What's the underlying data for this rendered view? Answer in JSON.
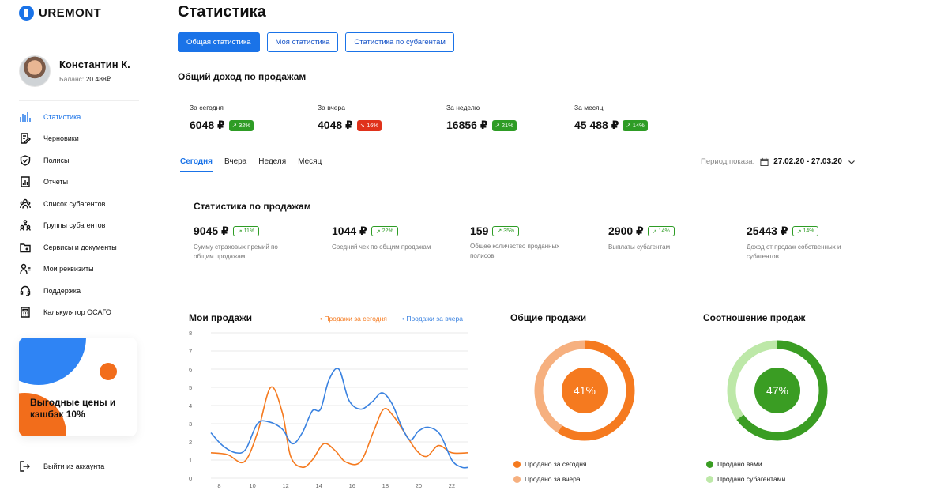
{
  "app": {
    "logo_text": "UREMONT"
  },
  "profile": {
    "name": "Константин К.",
    "balance_label": "Баланс:",
    "balance_value": "20 488₽"
  },
  "sidebar": {
    "items": [
      {
        "label": "Статистика",
        "icon": "bar-chart-icon",
        "active": true
      },
      {
        "label": "Черновики",
        "icon": "edit-document-icon"
      },
      {
        "label": "Полисы",
        "icon": "shield-icon"
      },
      {
        "label": "Отчеты",
        "icon": "report-icon"
      },
      {
        "label": "Список субагентов",
        "icon": "users-icon"
      },
      {
        "label": "Группы субагентов",
        "icon": "group-icon"
      },
      {
        "label": "Сервисы и документы",
        "icon": "folder-icon"
      },
      {
        "label": "Мои реквизиты",
        "icon": "user-details-icon"
      },
      {
        "label": "Поддержка",
        "icon": "headset-icon"
      },
      {
        "label": "Калькулятор ОСАГО",
        "icon": "calculator-icon"
      }
    ],
    "promo_text": "Выгодные цены и кэшбэк 10%",
    "logout_label": "Выйти из аккаунта"
  },
  "page": {
    "title": "Статистика",
    "tabs": [
      "Общая статистика",
      "Моя статистика",
      "Статистика по субагентам"
    ]
  },
  "income": {
    "title": "Общий доход по продажам",
    "items": [
      {
        "label": "За сегодня",
        "value": "6048 ₽",
        "badge": "32%",
        "trend": "up"
      },
      {
        "label": "За вчера",
        "value": "4048 ₽",
        "badge": "16%",
        "trend": "down"
      },
      {
        "label": "За неделю",
        "value": "16856 ₽",
        "badge": "21%",
        "trend": "up"
      },
      {
        "label": "За месяц",
        "value": "45 488 ₽",
        "badge": "14%",
        "trend": "up"
      }
    ]
  },
  "period_tabs": [
    "Сегодня",
    "Вчера",
    "Неделя",
    "Месяц"
  ],
  "period": {
    "label": "Период показа:",
    "value": "27.02.20 - 27.03.20"
  },
  "sales_stats": {
    "title": "Статистика по продажам",
    "items": [
      {
        "value": "9045 ₽",
        "badge": "11%",
        "desc": "Сумму страховых премий по общим продажам"
      },
      {
        "value": "1044 ₽",
        "badge": "22%",
        "desc": "Средний чек по общим продажам"
      },
      {
        "value": "159",
        "badge": "35%",
        "desc": "Общее количество проданных полисов"
      },
      {
        "value": "2900 ₽",
        "badge": "14%",
        "desc": "Выплаты субагентам"
      },
      {
        "value": "25443 ₽",
        "badge": "14%",
        "desc": "Доход от продаж собственных и субагентов"
      }
    ]
  },
  "colors": {
    "accent": "#1a73e8",
    "orange": "#f57a1f",
    "orange_light": "#f6b07f",
    "green": "#3a9d23",
    "green_light": "#bde8a8",
    "up": "#2e9c25",
    "down": "#e0321b"
  },
  "chart_data": [
    {
      "type": "line",
      "title": "Мои продажи",
      "xlim": [
        7.5,
        23
      ],
      "ylim": [
        0,
        8
      ],
      "xticks": [
        8,
        10,
        12,
        14,
        16,
        18,
        20,
        22
      ],
      "yticks": [
        0,
        1,
        2,
        3,
        4,
        5,
        6,
        7,
        8
      ],
      "grid": true,
      "legend_position": "top-right",
      "series": [
        {
          "name": "Продажи за сегодня",
          "color": "#f57a1f",
          "points": [
            [
              7.5,
              1.4
            ],
            [
              8.5,
              1.3
            ],
            [
              9.5,
              0.9
            ],
            [
              10.3,
              2.5
            ],
            [
              11.1,
              5.0
            ],
            [
              11.8,
              3.6
            ],
            [
              12.3,
              1.2
            ],
            [
              13.0,
              0.6
            ],
            [
              13.6,
              1.0
            ],
            [
              14.3,
              1.9
            ],
            [
              15.0,
              1.5
            ],
            [
              15.6,
              0.9
            ],
            [
              16.5,
              0.9
            ],
            [
              17.3,
              2.6
            ],
            [
              17.9,
              3.8
            ],
            [
              18.5,
              3.4
            ],
            [
              19.3,
              2.3
            ],
            [
              19.9,
              1.5
            ],
            [
              20.5,
              1.2
            ],
            [
              21.2,
              1.8
            ],
            [
              22.0,
              1.4
            ],
            [
              23.0,
              1.4
            ]
          ]
        },
        {
          "name": "Продажи за вчера",
          "color": "#3a82e0",
          "points": [
            [
              7.5,
              2.5
            ],
            [
              8.2,
              1.8
            ],
            [
              9.0,
              1.4
            ],
            [
              9.6,
              1.6
            ],
            [
              10.3,
              3.0
            ],
            [
              11.0,
              3.1
            ],
            [
              11.8,
              2.7
            ],
            [
              12.4,
              1.9
            ],
            [
              13.0,
              2.5
            ],
            [
              13.6,
              3.7
            ],
            [
              14.1,
              3.8
            ],
            [
              14.6,
              5.4
            ],
            [
              15.2,
              6.0
            ],
            [
              15.8,
              4.3
            ],
            [
              16.5,
              3.8
            ],
            [
              17.2,
              4.2
            ],
            [
              17.8,
              4.7
            ],
            [
              18.4,
              4.1
            ],
            [
              19.0,
              2.8
            ],
            [
              19.5,
              2.1
            ],
            [
              20.0,
              2.6
            ],
            [
              20.6,
              2.8
            ],
            [
              21.3,
              2.4
            ],
            [
              22.0,
              1.0
            ],
            [
              22.6,
              0.6
            ],
            [
              23.0,
              0.6
            ]
          ]
        }
      ]
    },
    {
      "type": "pie",
      "title": "Общие продажи",
      "center_label": "41%",
      "categories": [
        "Продано за сегодня",
        "Продано за вчера"
      ],
      "values": [
        59,
        41
      ],
      "colors": [
        "#f57a1f",
        "#f6b07f"
      ]
    },
    {
      "type": "pie",
      "title": "Соотношение продаж",
      "center_label": "47%",
      "categories": [
        "Продано вами",
        "Продано субагентами"
      ],
      "values": [
        65,
        35
      ],
      "colors": [
        "#3a9d23",
        "#bde8a8"
      ]
    }
  ]
}
